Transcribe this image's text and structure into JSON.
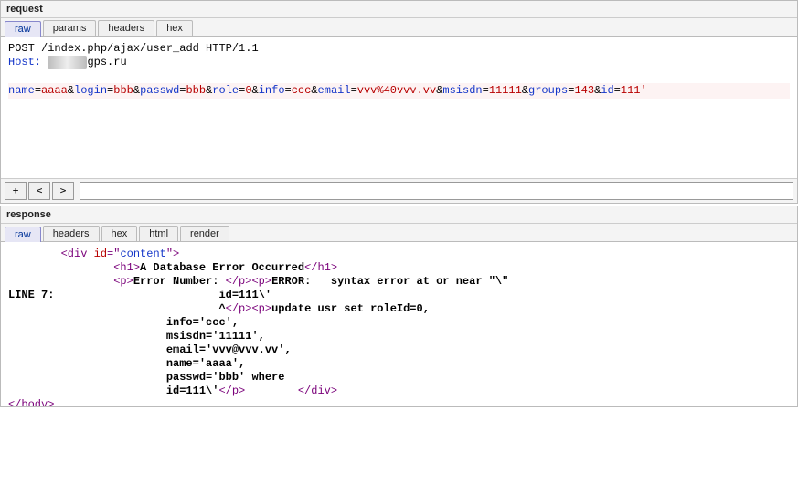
{
  "request_panel": {
    "title": "request",
    "tabs": [
      "raw",
      "params",
      "headers",
      "hex"
    ],
    "active": "raw",
    "method": "POST",
    "path": "/index.php/ajax/user_add",
    "http_version": "HTTP/1.1",
    "host_label": "Host:",
    "host_redacted": "xxxxxx",
    "host_suffix": "gps.ru",
    "body_pairs": [
      {
        "k": "name",
        "v": "aaaa"
      },
      {
        "k": "login",
        "v": "bbb"
      },
      {
        "k": "passwd",
        "v": "bbb"
      },
      {
        "k": "role",
        "v": "0"
      },
      {
        "k": "info",
        "v": "ccc"
      },
      {
        "k": "email",
        "v": "vvv%40vvv.vv"
      },
      {
        "k": "msisdn",
        "v": "11111"
      },
      {
        "k": "groups",
        "v": "143"
      },
      {
        "k": "id",
        "v": "111'"
      }
    ]
  },
  "control_row": {
    "btn_plus": "+",
    "btn_prev": "<",
    "btn_next": ">"
  },
  "response_panel": {
    "title": "response",
    "tabs": [
      "raw",
      "headers",
      "hex",
      "html",
      "render"
    ],
    "active": "raw",
    "indent1": "        ",
    "indent2": "                ",
    "indent3": "                        ",
    "indent3b": "                               ",
    "line7_lbl": "LINE 7:",
    "line7_pad": "                         ",
    "div_open_a": "<div ",
    "div_attr_id": "id",
    "div_attr_eq": "=\"",
    "div_attr_val": "content",
    "div_attr_close": "\">",
    "h1_open": "<h1>",
    "h1_text": "A Database Error Occurred",
    "h1_close": "</h1>",
    "p_open": "<p>",
    "p_close": "</p>",
    "err_num_lbl": "Error Number: ",
    "err_msg1": "ERROR:   syntax error at or near \"\\\"",
    "err_msg2": "id=111\\'",
    "caret": "^",
    "update_sql": "update usr set roleId=0,",
    "sql_info": "info='ccc',",
    "sql_msisdn": "msisdn='11111',",
    "sql_email": "email='vvv@vvv.vv',",
    "sql_name": "name='aaaa',",
    "sql_passwd": "passwd='bbb' where",
    "sql_id": "id=111\\'",
    "div_close": "</div>",
    "body_close": "</body>"
  }
}
